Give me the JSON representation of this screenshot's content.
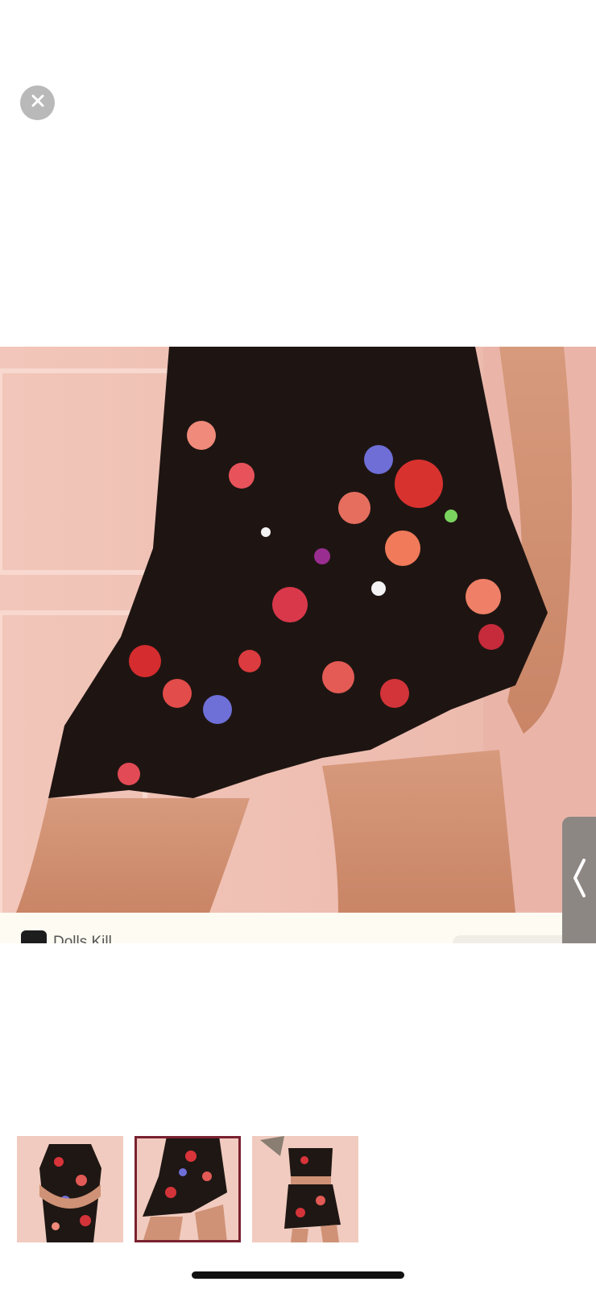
{
  "controls": {
    "close_icon": "close-icon",
    "side_tab_icon": "chevron-left-icon"
  },
  "product_image": {
    "brand_name": "Dolls Kill"
  },
  "thumbnails": {
    "count": 3,
    "selected_index": 1
  },
  "colors": {
    "thumbnail_selected_border": "#7a2130",
    "close_button_bg": "#b9b9b9",
    "side_tab_bg": "#8d8784"
  }
}
